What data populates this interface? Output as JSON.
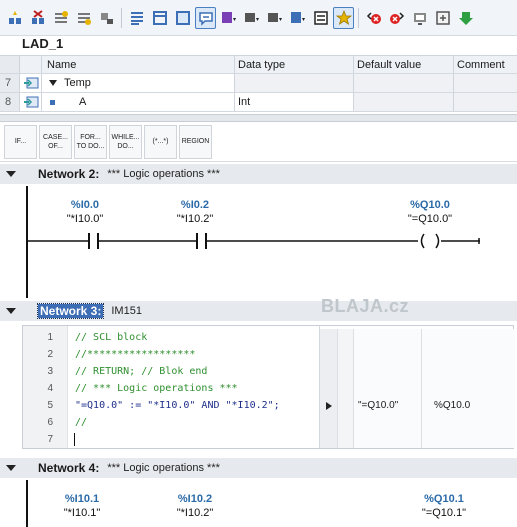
{
  "toolbar": {
    "icons": [
      "insert-network-icon",
      "delete-network-icon",
      "insert-row-icon",
      "add-row-icon",
      "crossed-icon",
      "list-icon",
      "view-icon",
      "box-icon",
      "comment-view-icon",
      "abs-symbol-icon",
      "sym-icon",
      "abs-icon",
      "sym-table-icon",
      "list-sym-icon",
      "favorites-icon",
      "prev-error-icon",
      "next-error-icon",
      "monitor-icon",
      "compare-icon",
      "download-icon"
    ]
  },
  "block": {
    "title": "LAD_1"
  },
  "interface": {
    "headers": {
      "name": "Name",
      "type": "Data type",
      "default": "Default value",
      "comment": "Comment"
    },
    "rows": [
      {
        "num": "7",
        "name": "Temp",
        "type": "",
        "default": "",
        "comment": ""
      },
      {
        "num": "8",
        "name": "A",
        "type": "Int",
        "default": "",
        "comment": ""
      }
    ]
  },
  "palette": {
    "buttons": [
      "IF...",
      "CASE... OF...",
      "FOR... TO DO...",
      "WHILE... DO...",
      "(*...*)",
      "REGION"
    ]
  },
  "networks": {
    "n2": {
      "title": "Network 2:",
      "comment": "*** Logic operations ***",
      "contacts": [
        {
          "abs": "%I0.0",
          "sym": "\"*I10.0\""
        },
        {
          "abs": "%I0.2",
          "sym": "\"*I10.2\""
        }
      ],
      "coil": {
        "abs": "%Q10.0",
        "sym": "\"=Q10.0\""
      }
    },
    "n3": {
      "title": "Network 3:",
      "comment": "IM151",
      "lines": [
        {
          "n": "1",
          "code": "// SCL block"
        },
        {
          "n": "2",
          "code": "//******************"
        },
        {
          "n": "3",
          "code": "// RETURN; // Blok end"
        },
        {
          "n": "4",
          "code": "// *** Logic operations ***"
        },
        {
          "n": "5",
          "code": "\"=Q10.0\" := \"*I10.0\" AND \"*I10.2\";"
        },
        {
          "n": "6",
          "code": "//"
        },
        {
          "n": "7",
          "code": ""
        }
      ],
      "watch": {
        "symbol": "\"=Q10.0\"",
        "address": "%Q10.0"
      }
    },
    "n4": {
      "title": "Network 4:",
      "comment": "*** Logic operations ***",
      "contacts": [
        {
          "abs": "%I10.1",
          "sym": "\"*I10.1\""
        },
        {
          "abs": "%I10.2",
          "sym": "\"*I10.2\""
        }
      ],
      "coil": {
        "abs": "%Q10.1",
        "sym": "\"=Q10.1\""
      }
    }
  },
  "watermark": "BLAJA.cz"
}
